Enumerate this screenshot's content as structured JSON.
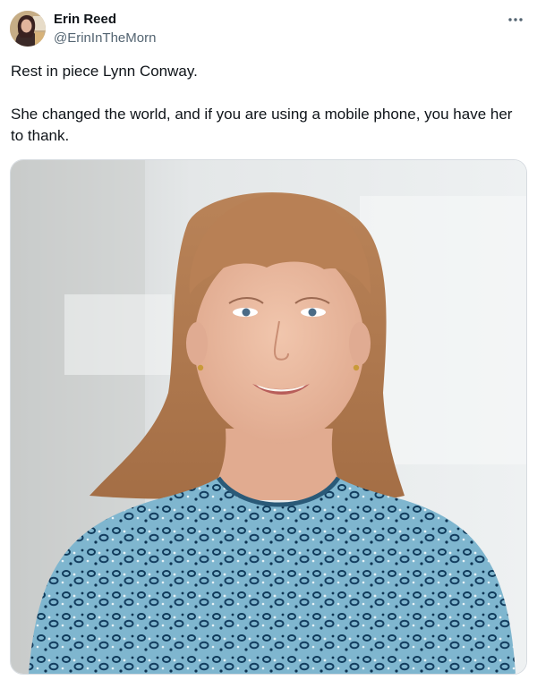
{
  "author": {
    "display_name": "Erin Reed",
    "handle": "@ErinInTheMorn"
  },
  "tweet": {
    "paragraphs": [
      "Rest in piece Lynn Conway.",
      "She changed the world, and if you are using a mobile phone, you have her to thank."
    ]
  },
  "icons": {
    "more": "more-horizontal-icon",
    "avatar": "profile-photo",
    "media": "portrait-photo"
  },
  "colors": {
    "text": "#0f1419",
    "secondary": "#536471",
    "border": "#d6dbe0"
  }
}
